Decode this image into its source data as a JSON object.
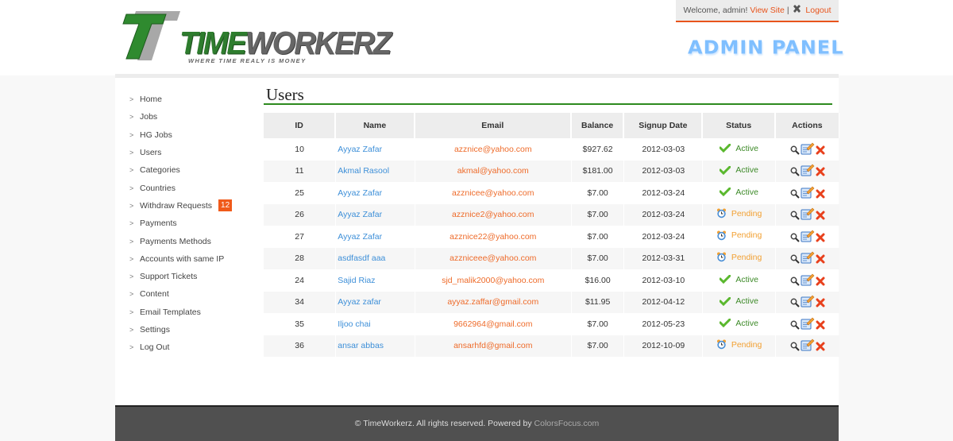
{
  "header": {
    "logo_part1": "TIME",
    "logo_part2": "WORKERZ",
    "tagline": "WHERE TIME REALY IS MONEY",
    "admin_panel": "ADMIN PANEL"
  },
  "topbar": {
    "welcome": "Welcome, admin!",
    "view_site": "View Site",
    "separator": "|",
    "logout": "Logout"
  },
  "sidebar": {
    "items": [
      {
        "label": "Home"
      },
      {
        "label": "Jobs"
      },
      {
        "label": "HG Jobs"
      },
      {
        "label": "Users"
      },
      {
        "label": "Categories"
      },
      {
        "label": "Countries"
      },
      {
        "label": "Withdraw Requests",
        "badge": "12"
      },
      {
        "label": "Payments"
      },
      {
        "label": "Payments Methods"
      },
      {
        "label": "Accounts with same IP"
      },
      {
        "label": "Support Tickets"
      },
      {
        "label": "Content"
      },
      {
        "label": "Email Templates"
      },
      {
        "label": "Settings"
      },
      {
        "label": "Log Out"
      }
    ]
  },
  "main": {
    "title": "Users",
    "columns": [
      "ID",
      "Name",
      "Email",
      "Balance",
      "Signup Date",
      "Status",
      "Actions"
    ],
    "rows": [
      {
        "id": "10",
        "name": "Ayyaz Zafar",
        "email": "azznice@yahoo.com",
        "balance": "$927.62",
        "signup": "2012-03-03",
        "status": "Active"
      },
      {
        "id": "11",
        "name": "Akmal Rasool",
        "email": "akmal@yahoo.com",
        "balance": "$181.00",
        "signup": "2012-03-03",
        "status": "Active"
      },
      {
        "id": "25",
        "name": "Ayyaz Zafar",
        "email": "azznicee@yahoo.com",
        "balance": "$7.00",
        "signup": "2012-03-24",
        "status": "Active"
      },
      {
        "id": "26",
        "name": "Ayyaz Zafar",
        "email": "azznice2@yahoo.com",
        "balance": "$7.00",
        "signup": "2012-03-24",
        "status": "Pending"
      },
      {
        "id": "27",
        "name": "Ayyaz Zafar",
        "email": "azznice22@yahoo.com",
        "balance": "$7.00",
        "signup": "2012-03-24",
        "status": "Pending"
      },
      {
        "id": "28",
        "name": "asdfasdf aaa",
        "email": "azzniceee@yahoo.com",
        "balance": "$7.00",
        "signup": "2012-03-31",
        "status": "Pending"
      },
      {
        "id": "24",
        "name": "Sajid Riaz",
        "email": "sjd_malik2000@yahoo.com",
        "balance": "$16.00",
        "signup": "2012-03-10",
        "status": "Active"
      },
      {
        "id": "34",
        "name": "Ayyaz zafar",
        "email": "ayyaz.zaffar@gmail.com",
        "balance": "$11.95",
        "signup": "2012-04-12",
        "status": "Active"
      },
      {
        "id": "35",
        "name": "Iljoo chai",
        "email": "9662964@gmail.com",
        "balance": "$7.00",
        "signup": "2012-05-23",
        "status": "Active"
      },
      {
        "id": "36",
        "name": "ansar abbas",
        "email": "ansarhfd@gmail.com",
        "balance": "$7.00",
        "signup": "2012-10-09",
        "status": "Pending"
      }
    ]
  },
  "footer": {
    "text": "© TimeWorkerz. All rights reserved. Powered by",
    "link": "ColorsFocus.com"
  },
  "colors": {
    "accent_orange": "#e8541c",
    "title_green": "#2d8a1e",
    "link_blue": "#3d8fd8",
    "email_orange": "#ee6b2a",
    "active_green": "#3d8a28",
    "pending_orange": "#f2a032"
  }
}
